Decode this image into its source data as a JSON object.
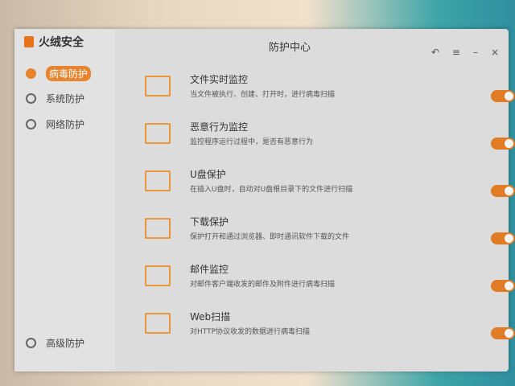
{
  "app": {
    "name": "火绒安全",
    "title": "防护中心"
  },
  "sidebar": {
    "items": [
      {
        "label": "病毒防护",
        "active": true
      },
      {
        "label": "系统防护"
      },
      {
        "label": "网络防护"
      }
    ],
    "bottom": "高级防护"
  },
  "controls": {
    "back": "↶",
    "menu": "≡",
    "min": "–",
    "close": "×"
  },
  "features": [
    {
      "name": "文件实时监控",
      "desc": "当文件被执行、创建、打开时，进行病毒扫描",
      "icon": "folder-icon",
      "on": true
    },
    {
      "name": "恶意行为监控",
      "desc": "监控程序运行过程中，是否有恶意行为",
      "icon": "behavior-monitor-icon",
      "on": true
    },
    {
      "name": "U盘保护",
      "desc": "在插入U盘时，自动对U盘根目录下的文件进行扫描",
      "icon": "usb-drive-icon",
      "on": true
    },
    {
      "name": "下载保护",
      "desc": "保护打开和通过浏览器、即时通讯软件下载的文件",
      "icon": "download-icon",
      "on": true
    },
    {
      "name": "邮件监控",
      "desc": "对邮件客户端收发的邮件及附件进行病毒扫描",
      "icon": "mail-icon",
      "on": true
    },
    {
      "name": "Web扫描",
      "desc": "对HTTP协议收发的数据进行病毒扫描",
      "icon": "web-scan-icon",
      "on": true
    }
  ],
  "colors": {
    "accent": "#e07c25"
  }
}
